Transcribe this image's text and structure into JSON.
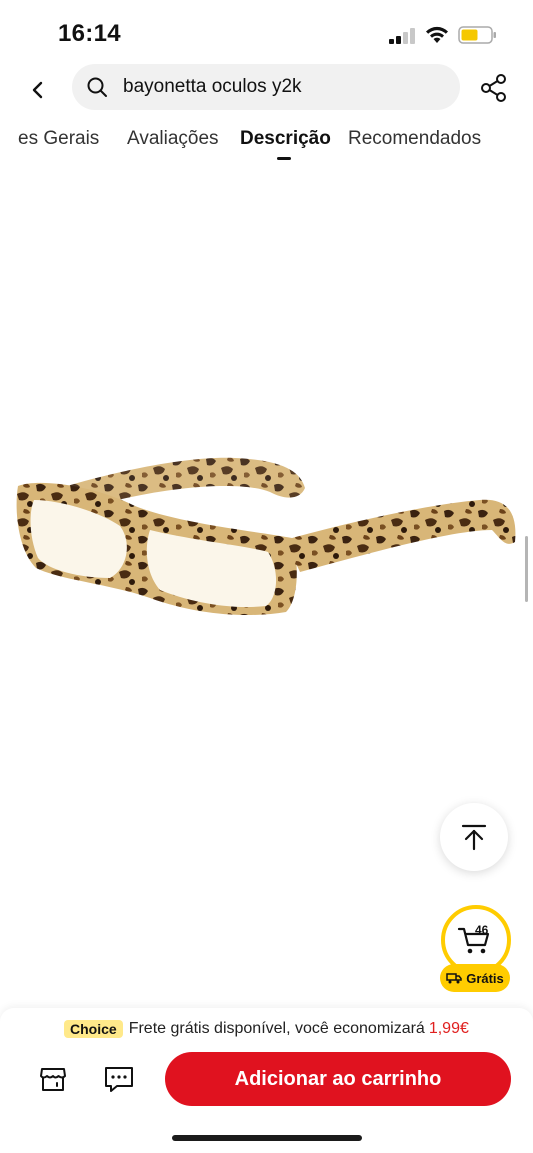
{
  "status_bar": {
    "time": "16:14",
    "battery_color": "#f5c800"
  },
  "search": {
    "query": "bayonetta oculos y2k"
  },
  "tabs": [
    {
      "label": "es Gerais"
    },
    {
      "label": "Avaliações"
    },
    {
      "label": "Descrição",
      "active": true
    },
    {
      "label": "Recomendados"
    }
  ],
  "floating": {
    "cart_count": "46",
    "free_shipping_label": "Grátis"
  },
  "bottom_bar": {
    "choice_label": "Choice",
    "shipping_text": "Frete grátis disponível, você economizará",
    "savings": "1,99€",
    "add_to_cart": "Adicionar ao carrinho"
  },
  "colors": {
    "accent": "#e0121f",
    "choice": "#ffe98a",
    "highlight": "#ffcc00",
    "savings": "#e0201f"
  },
  "icons": [
    "back-icon",
    "search-icon",
    "share-icon",
    "back-to-top-icon",
    "cart-icon",
    "truck-icon",
    "store-icon",
    "chat-icon"
  ]
}
